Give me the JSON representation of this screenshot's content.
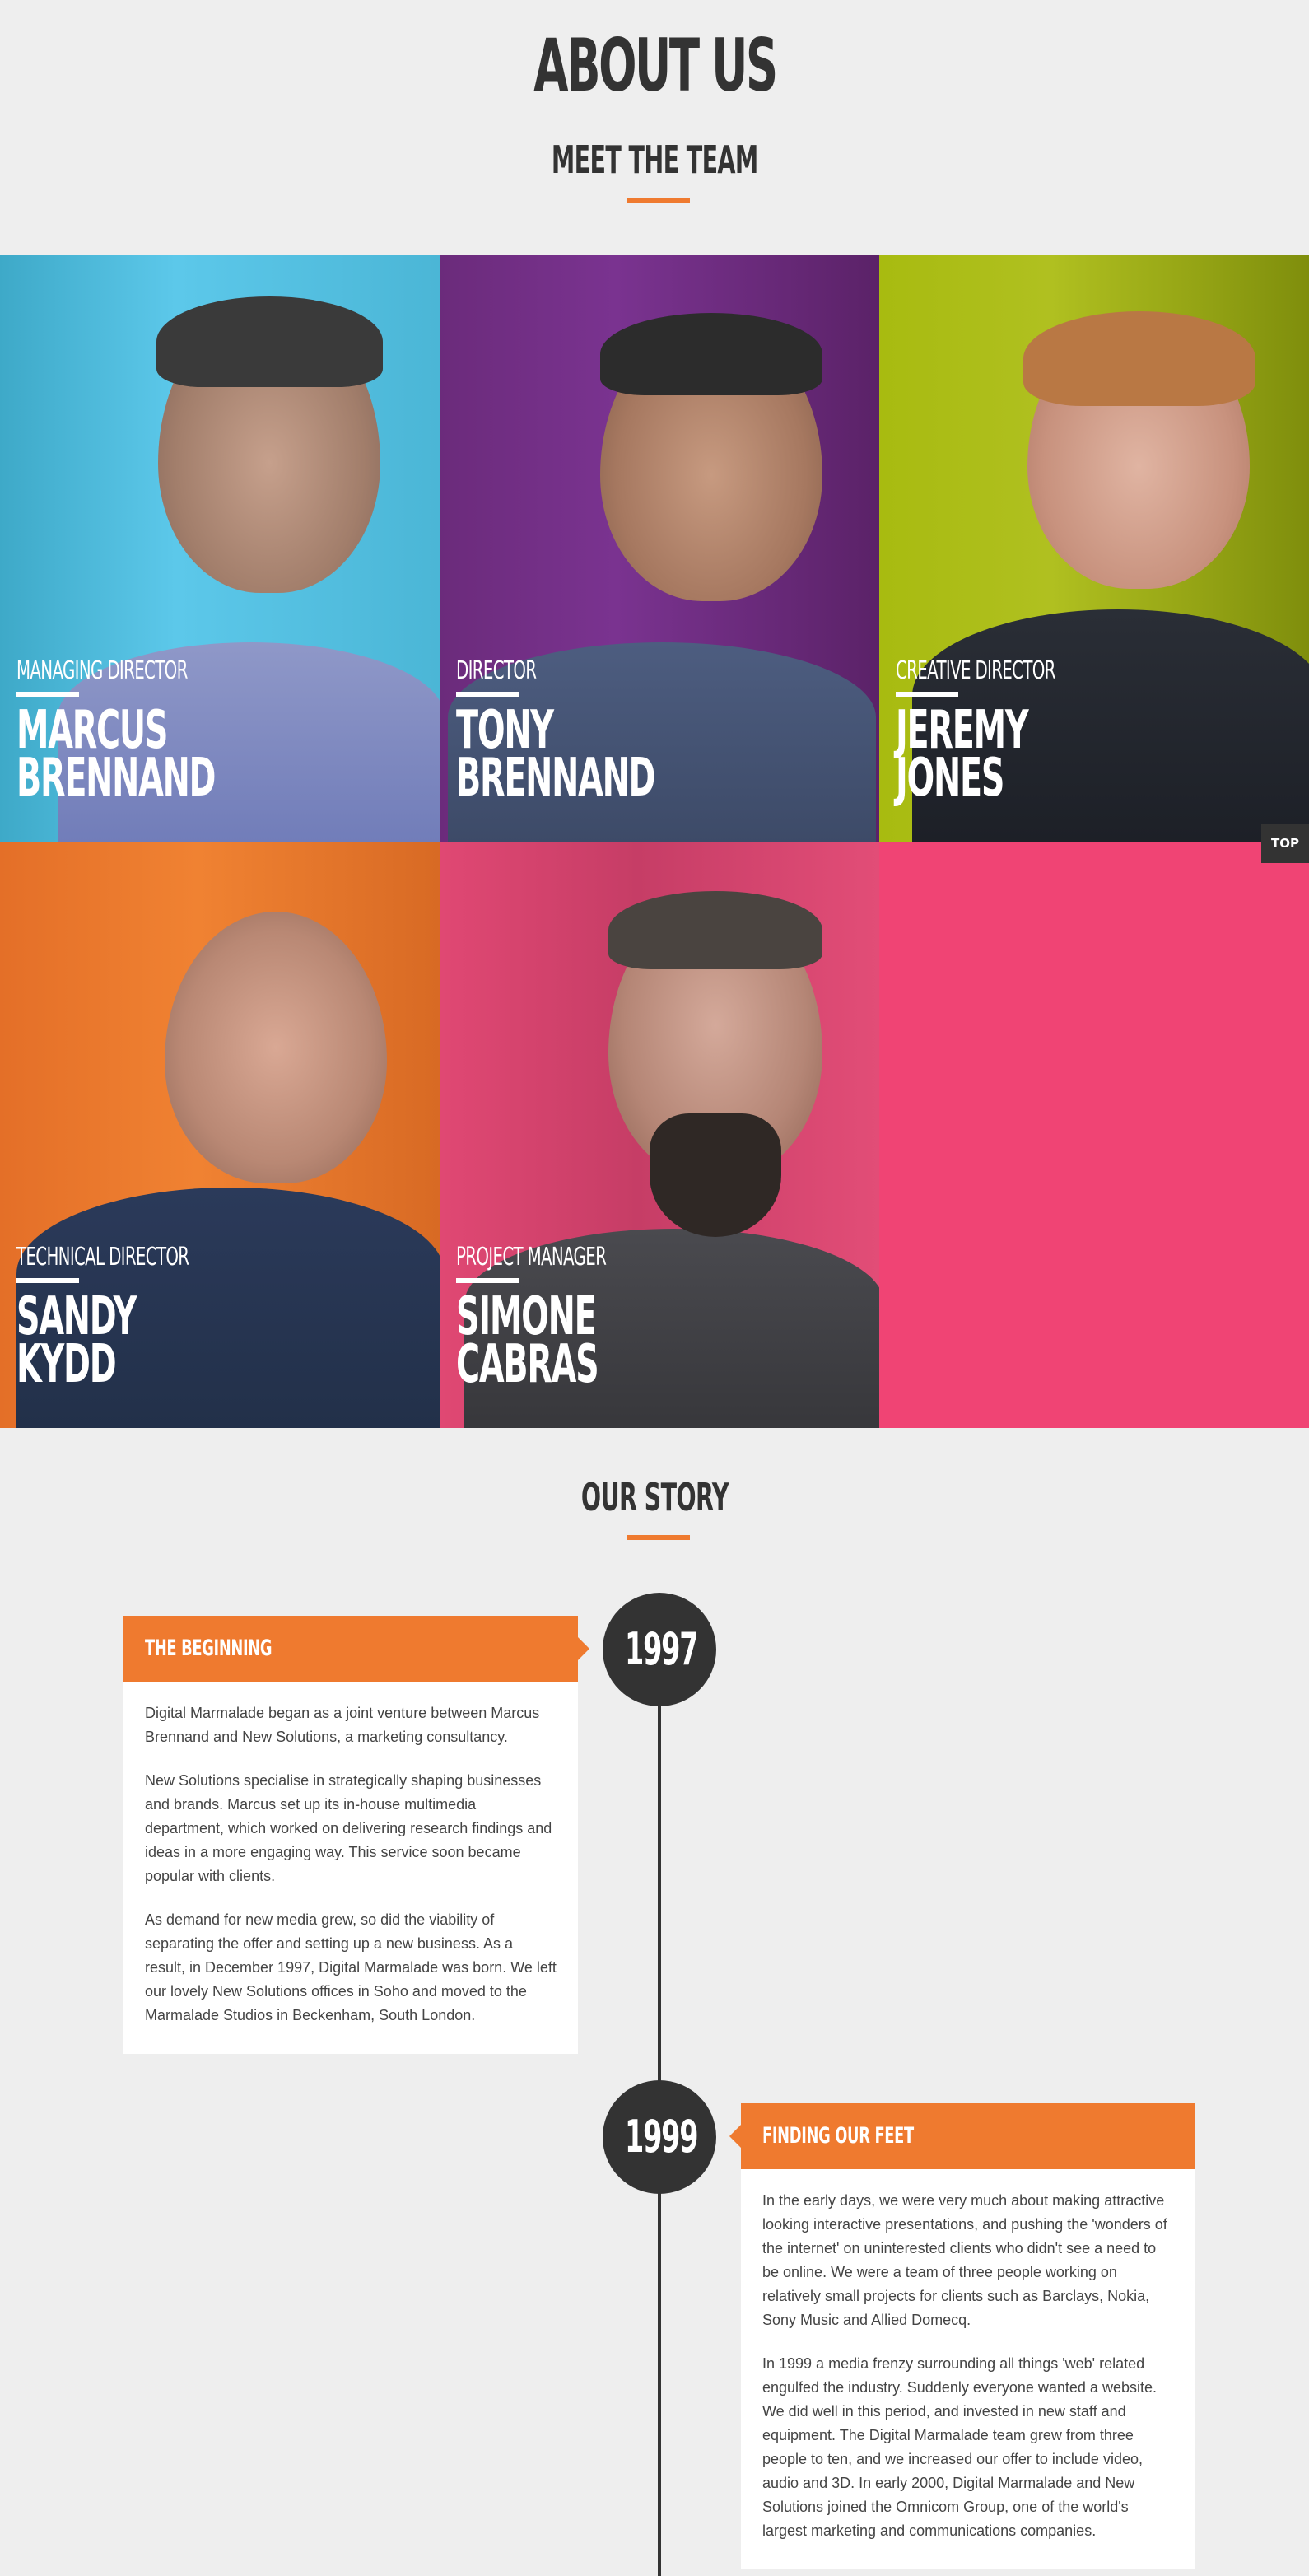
{
  "header": {
    "title": "ABOUT US",
    "team_heading": "MEET THE TEAM"
  },
  "team": [
    {
      "role": "MANAGING DIRECTOR",
      "first": "MARCUS",
      "last": "BRENNAND",
      "bg": "#4ec3e4"
    },
    {
      "role": "DIRECTOR",
      "first": "TONY",
      "last": "BRENNAND",
      "bg": "#6a2a78"
    },
    {
      "role": "CREATIVE DIRECTOR",
      "first": "JEREMY",
      "last": "JONES",
      "bg": "#a3b814"
    },
    {
      "role": "TECHNICAL DIRECTOR",
      "first": "SANDY",
      "last": "KYDD",
      "bg": "#ef7a2f"
    },
    {
      "role": "PROJECT MANAGER",
      "first": "SIMONE",
      "last": "CABRAS",
      "bg": "#e24670"
    }
  ],
  "empty_tile_color": "#f04474",
  "top_button": "TOP",
  "story": {
    "heading": "OUR STORY",
    "entries": [
      {
        "year": "1997",
        "title": "THE BEGINNING",
        "paragraphs": [
          "Digital Marmalade began as a joint venture between Marcus Brennand and New Solutions, a marketing consultancy.",
          "New Solutions specialise in strategically shaping businesses and brands. Marcus set up its in-house multimedia department, which worked on delivering research findings and ideas in a more engaging way. This service soon became popular with clients.",
          "As demand for new media grew, so did the viability of separating the offer and setting up a new business. As a result, in December 1997, Digital Marmalade was born. We left our lovely New Solutions offices in Soho and moved to the Marmalade Studios in Beckenham, South London."
        ]
      },
      {
        "year": "1999",
        "title": "FINDING OUR FEET",
        "paragraphs": [
          "In the early days, we were very much about making attractive looking interactive presentations, and pushing the 'wonders of the internet' on uninterested clients who didn't see a need to be online. We were a team of three people working on relatively small projects for clients such as Barclays, Nokia, Sony Music and Allied Domecq.",
          "In 1999 a media frenzy surrounding all things 'web' related engulfed the industry. Suddenly everyone wanted a website. We did well in this period, and invested in new staff and equipment. The Digital Marmalade team grew from three people to ten, and we increased our offer to include video, audio and 3D. In early 2000, Digital Marmalade and New Solutions joined the Omnicom Group, one of the world's largest marketing and communications companies."
        ]
      }
    ]
  },
  "colors": {
    "accent": "#ef7a2f",
    "dark": "#333333",
    "background": "#eeeeee"
  }
}
